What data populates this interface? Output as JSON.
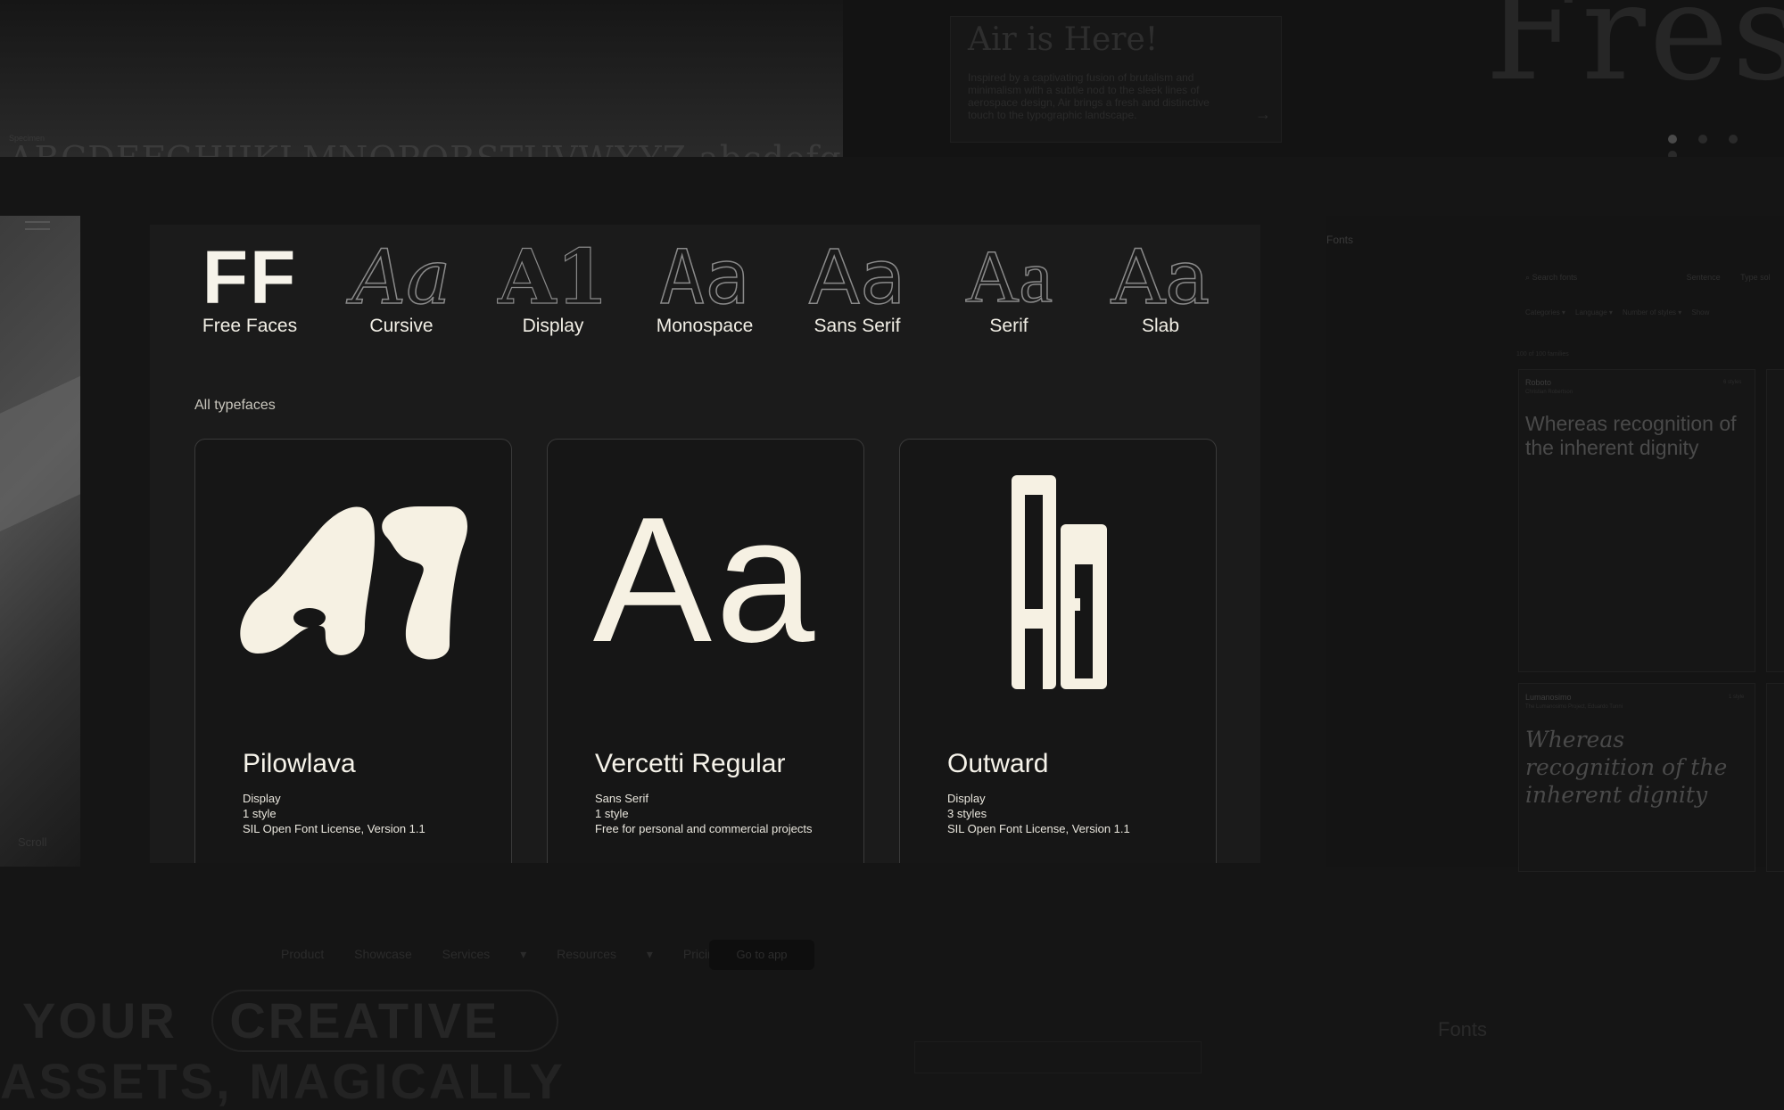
{
  "background": {
    "top_right": {
      "title": "Air is Here!",
      "body": "Inspired by a captivating fusion of brutalism and minimalism with a subtle nod to the sleek lines of aerospace design, Air brings a fresh and distinctive touch to the typographic landscape.",
      "arrow": "→",
      "display_word": "Fres"
    },
    "left_panel": {
      "scroll_label": "Scroll"
    },
    "right_panel": {
      "crumb": "Fonts",
      "search_placeholder": "Search fonts",
      "sentence_label": "Sentence",
      "type_label": "Type sol",
      "filters": [
        "Categories",
        "Language",
        "Number of styles",
        "Show"
      ],
      "count": "100 of 100 families",
      "cards": [
        {
          "name": "Roboto",
          "designer": "Christian Robertson",
          "styles": "6 styles",
          "sample": "Whereas recognition of the inherent dignity"
        },
        {
          "name": "Lumanosimo",
          "designer": "The Lumanosimo Project, Eduardo Tunni",
          "styles": "1 style",
          "sample": "Whereas recognition of the inherent dignity"
        }
      ]
    },
    "bottom_left": {
      "nav": [
        "Product",
        "Showcase",
        "Services",
        "Resources",
        "Pricing"
      ],
      "cta": "Go to app",
      "headline_1a": "YOUR",
      "headline_1b": "CREATIVE",
      "headline_2": "ASSETS, MAGICALLY"
    },
    "bottom_right": {
      "label": "Fonts"
    }
  },
  "categories": [
    {
      "glyph": "FF",
      "label": "Free Faces",
      "icon": "ff-logo-icon"
    },
    {
      "glyph": "Aa",
      "label": "Cursive",
      "icon": "cursive-glyph-icon"
    },
    {
      "glyph": "A1",
      "label": "Display",
      "icon": "display-glyph-icon"
    },
    {
      "glyph": "Aa",
      "label": "Monospace",
      "icon": "monospace-glyph-icon"
    },
    {
      "glyph": "Aa",
      "label": "Sans Serif",
      "icon": "sans-serif-glyph-icon"
    },
    {
      "glyph": "Aa",
      "label": "Serif",
      "icon": "serif-glyph-icon"
    },
    {
      "glyph": "Aa",
      "label": "Slab",
      "icon": "slab-glyph-icon"
    }
  ],
  "section_title": "All typefaces",
  "typefaces": [
    {
      "name": "Pilowlava",
      "category": "Display",
      "styles": "1 style",
      "license": "SIL Open Font License, Version 1.1",
      "specimen": "A1"
    },
    {
      "name": "Vercetti Regular",
      "category": "Sans Serif",
      "styles": "1 style",
      "license": "Free for personal and commercial projects",
      "specimen": "Aa"
    },
    {
      "name": "Outward",
      "category": "Display",
      "styles": "3 styles",
      "license": "SIL Open Font License, Version 1.1",
      "specimen": "Aa"
    }
  ],
  "colors": {
    "background": "#151515",
    "panel": "#1b1b1b",
    "card": "#161616",
    "specimen": "#f6f1e3",
    "outline": "#8a8a8a"
  }
}
